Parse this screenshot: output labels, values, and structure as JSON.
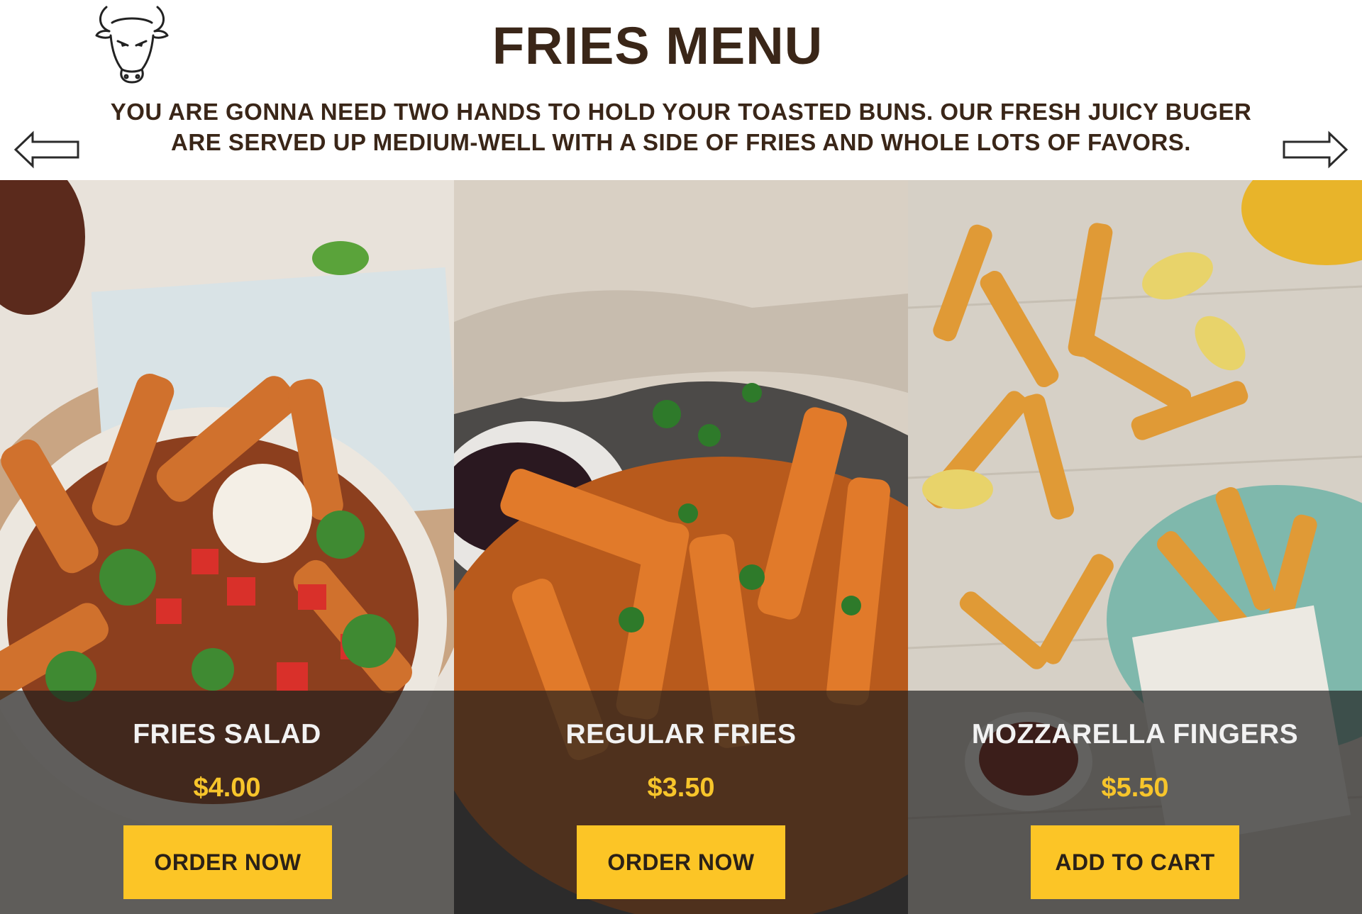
{
  "header": {
    "title": "FRIES MENU",
    "tagline_line1": "YOU ARE GONNA NEED TWO HANDS TO HOLD YOUR TOASTED BUNS. OUR FRESH JUICY BUGER",
    "tagline_line2": "ARE SERVED UP MEDIUM-WELL WITH A SIDE OF FRIES AND WHOLE LOTS OF FAVORS.",
    "logo_icon": "bull-head-icon"
  },
  "nav": {
    "prev_icon": "arrow-left-icon",
    "next_icon": "arrow-right-icon"
  },
  "colors": {
    "text_dark": "#3a2618",
    "price": "#f7c52b",
    "button_bg": "#fcc526",
    "overlay": "rgba(30,30,30,0.68)"
  },
  "items": [
    {
      "name": "FRIES SALAD",
      "price": "$4.00",
      "button": "ORDER NOW"
    },
    {
      "name": "REGULAR FRIES",
      "price": "$3.50",
      "button": "ORDER NOW"
    },
    {
      "name": "MOZZARELLA FINGERS",
      "price": "$5.50",
      "button": "ADD TO CART"
    }
  ]
}
